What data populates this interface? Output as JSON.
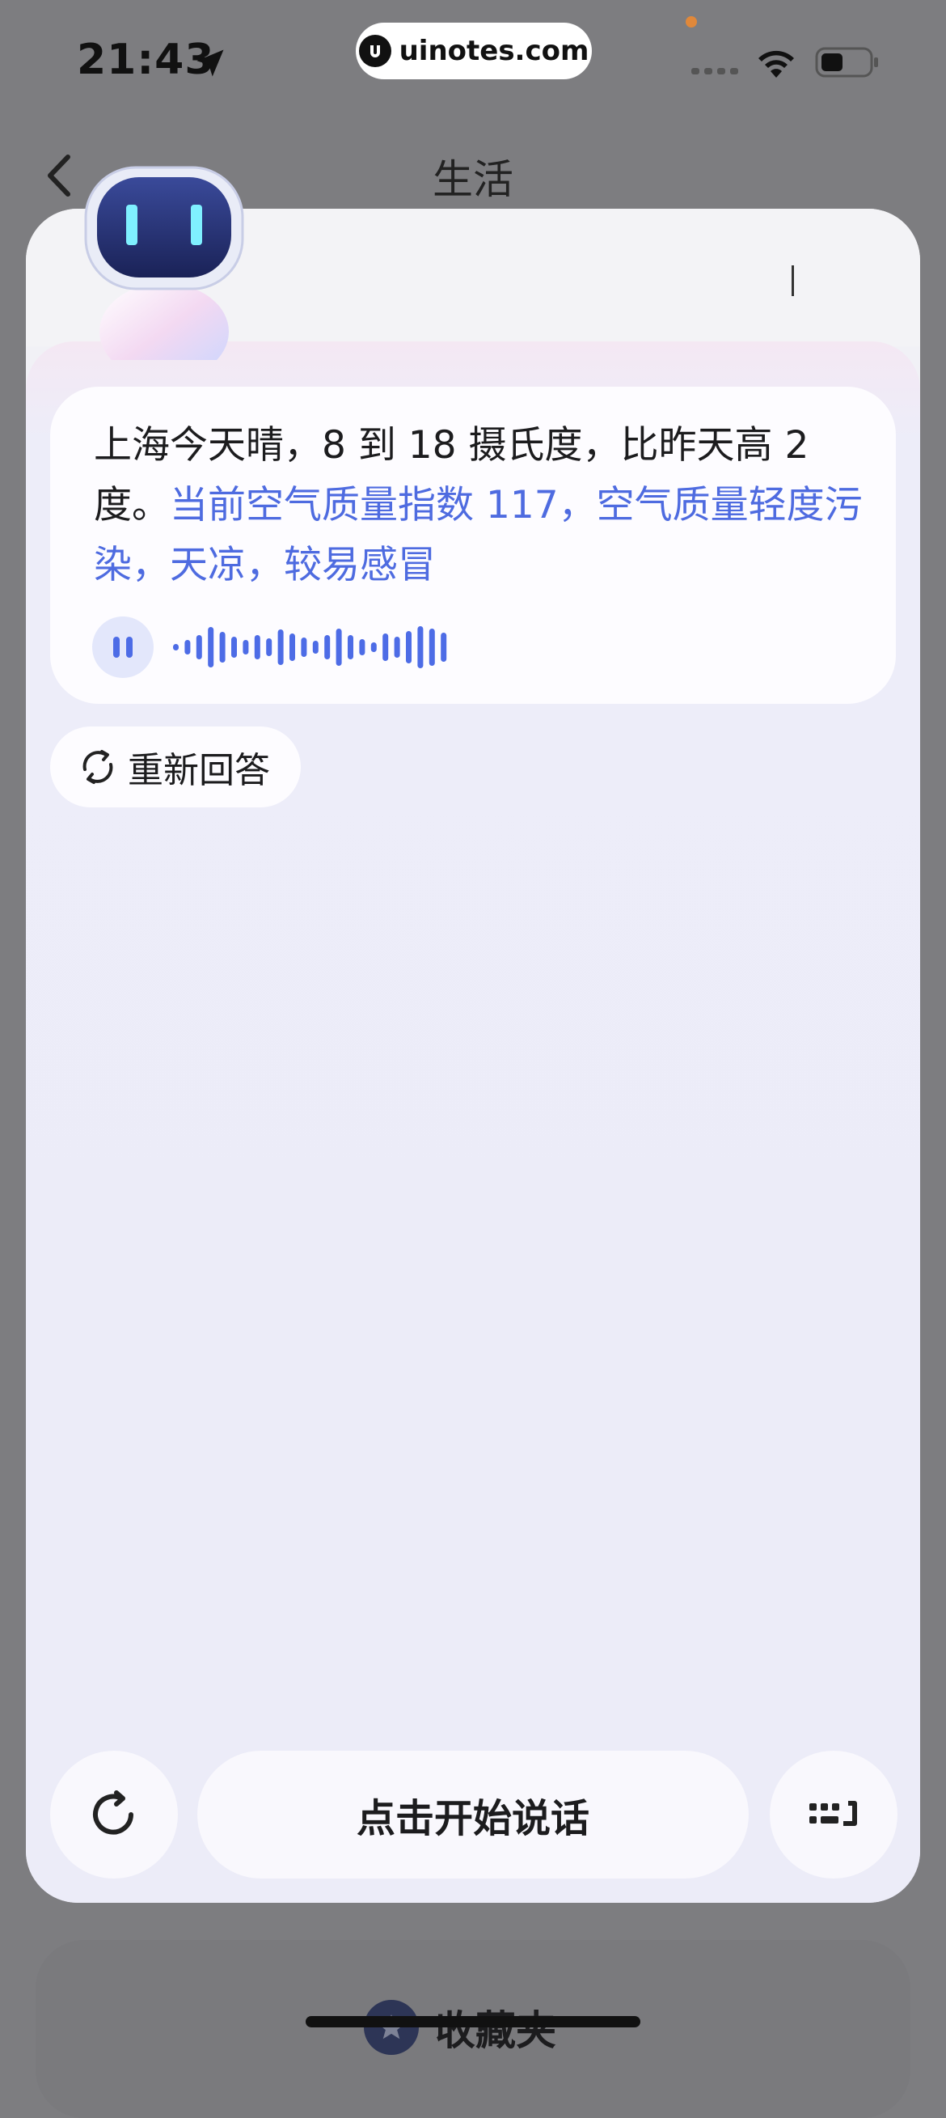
{
  "status_bar": {
    "time": "21:43",
    "watermark": "uinotes.com",
    "icons": [
      "location-arrow-icon",
      "cellular-signal-icon",
      "wifi-icon",
      "battery-icon"
    ]
  },
  "header": {
    "title": "生活",
    "back_icon": "chevron-left-icon"
  },
  "assistant": {
    "avatar": "robot-avatar",
    "answer": {
      "plain": "上海今天晴，8 到 18 摄氏度，比昨天高 2 度。",
      "highlighted": "当前空气质量指数 117，空气质量轻度污染，天凉，较易感冒"
    },
    "audio": {
      "state": "playing",
      "control_icon": "pause-icon"
    },
    "regenerate_label": "重新回答"
  },
  "controls": {
    "speak_label": "点击开始说话",
    "left_icon": "refresh-icon",
    "right_icon": "keyboard-icon"
  },
  "background_page": {
    "favorites_label": "收藏夹"
  },
  "colors": {
    "accent": "#4e6be0",
    "text": "#1c1c1e",
    "overlay": "#7d7d80",
    "panel": "#f1f1f6"
  }
}
